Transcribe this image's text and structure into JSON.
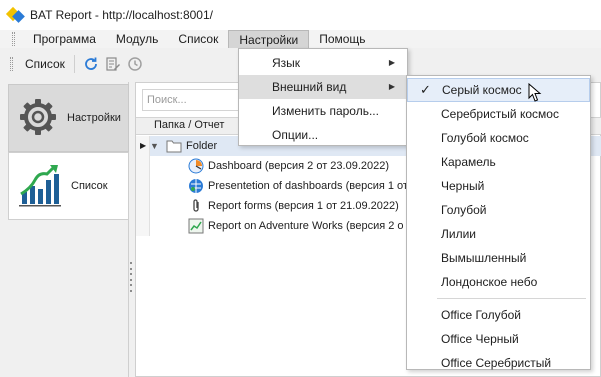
{
  "window": {
    "title": "BAT Report - http://localhost:8001/"
  },
  "menubar": {
    "items": [
      {
        "label": "Программа"
      },
      {
        "label": "Модуль"
      },
      {
        "label": "Список"
      },
      {
        "label": "Настройки"
      },
      {
        "label": "Помощь"
      }
    ]
  },
  "toolbar": {
    "list_label": "Список"
  },
  "nav": {
    "settings_label": "Настройки",
    "list_label": "Список"
  },
  "content": {
    "search_placeholder": "Поиск...",
    "column_header": "Папка / Отчет",
    "rows": [
      {
        "label": "Folder",
        "icon": "folder-icon"
      },
      {
        "label": "Dashboard (версия 2 от 23.09.2022)",
        "icon": "dashboard-icon"
      },
      {
        "label": "Presentetion of dashboards (версия 1 от",
        "icon": "presentation-globe-icon"
      },
      {
        "label": "Report forms (версия 1 от 21.09.2022)",
        "icon": "paperclip-icon"
      },
      {
        "label": "Report on Adventure Works (версия 2 о",
        "icon": "chart-report-icon"
      }
    ]
  },
  "settings_menu": {
    "items": [
      {
        "label": "Язык",
        "has_submenu": true
      },
      {
        "label": "Внешний вид",
        "has_submenu": true,
        "active": true
      },
      {
        "label": "Изменить пароль...",
        "has_submenu": false
      },
      {
        "label": "Опции...",
        "has_submenu": false
      }
    ]
  },
  "appearance_submenu": {
    "checked_label": "Серый космос",
    "items": [
      "Серый космос",
      "Серебристый космос",
      "Голубой космос",
      "Карамель",
      "Черный",
      "Голубой",
      "Лилии",
      "Вымышленный",
      "Лондонское небо"
    ],
    "office_items": [
      "Office Голубой",
      "Office Черный",
      "Office Серебристый"
    ]
  },
  "colors": {
    "accent_blue": "#2b7bd6",
    "logo_yellow": "#f2c200",
    "chart_green": "#2fa84f",
    "hover_bg": "#e6eef9",
    "menu_open_bg": "#d5d5d5"
  }
}
